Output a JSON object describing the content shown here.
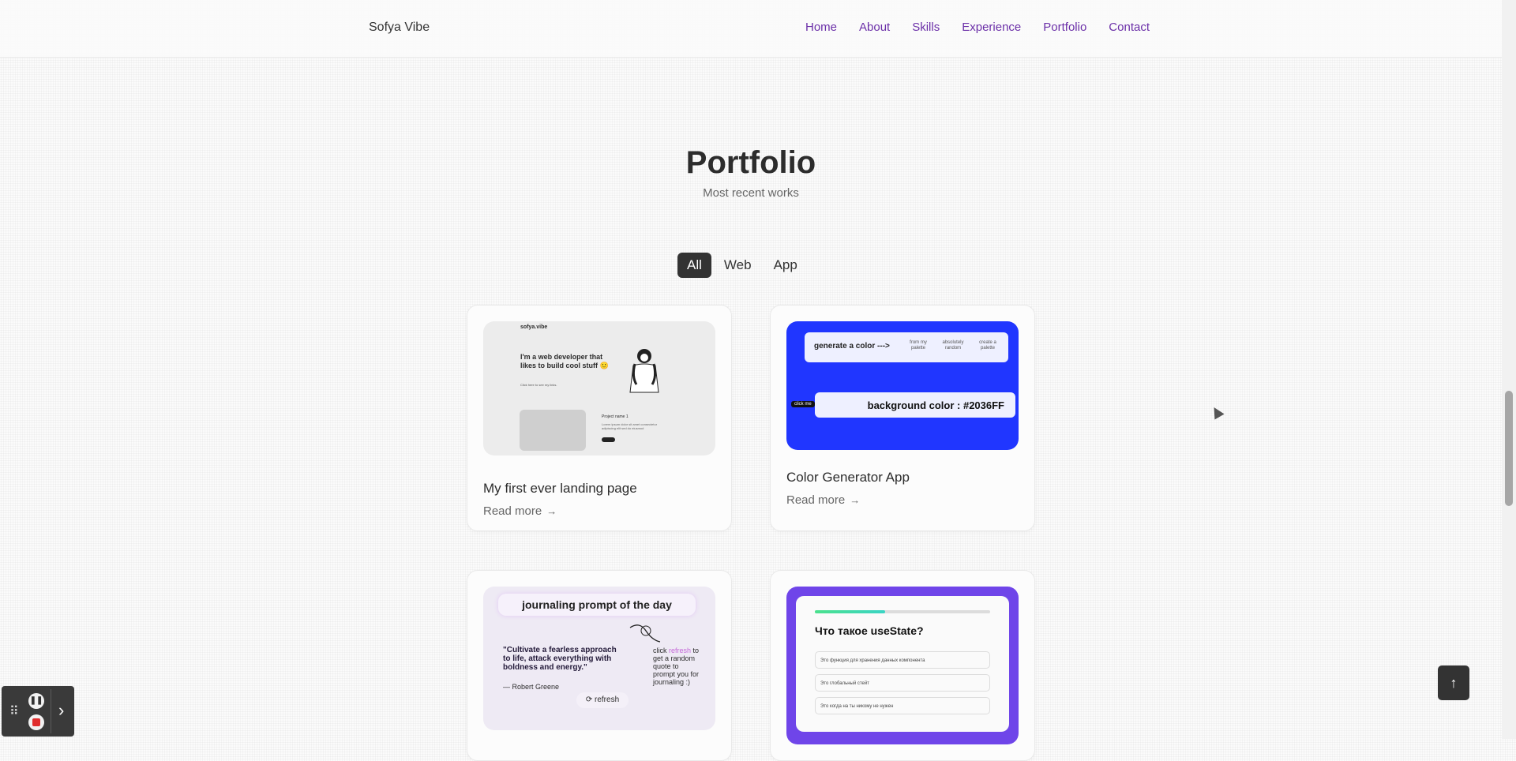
{
  "header": {
    "brand": "Sofya Vibe",
    "nav": [
      "Home",
      "About",
      "Skills",
      "Experience",
      "Portfolio",
      "Contact"
    ]
  },
  "section": {
    "title": "Portfolio",
    "subtitle": "Most recent works"
  },
  "filters": [
    {
      "label": "All",
      "active": true
    },
    {
      "label": "Web",
      "active": false
    },
    {
      "label": "App",
      "active": false
    }
  ],
  "cards": [
    {
      "title": "My first ever landing page",
      "more": "Read more",
      "thumb": {
        "logo": "sofya.vibe",
        "hero": "I'm a web developer that likes to build cool stuff 🙂",
        "small": "Click here to see my links.",
        "project": "Project name 1",
        "lines": "Lorem ipsum dolor sit amet consectetur adipiscing elit sed do eiusmod"
      }
    },
    {
      "title": "Color Generator App",
      "more": "Read more",
      "thumb": {
        "generate": "generate a color --->",
        "opt1": "from my palette",
        "opt2": "absolutely random",
        "opt3": "create a palette",
        "tag": "click me",
        "bg": "background color : #2036FF"
      }
    },
    {
      "thumb": {
        "bar": "journaling prompt of the day",
        "quote": "\"Cultivate a fearless approach to life, attack everything with boldness and energy.\"",
        "author": "— Robert Greene",
        "click_a": "click",
        "click_hl": "refresh",
        "click_b": "to get a random quote to prompt you for journaling :)",
        "refresh": "⟳ refresh"
      }
    },
    {
      "thumb": {
        "progress": 0.4,
        "question": "Что такое useState?",
        "answers": [
          "Это функция для хранения данных компонента",
          "Это глобальный стейт",
          "Это когда на ты никому не нужен"
        ]
      }
    }
  ],
  "icons": {
    "arrow": "→",
    "scroll_top": "↑",
    "pause": "❚❚",
    "grip": "⠿",
    "chevron": "›"
  }
}
